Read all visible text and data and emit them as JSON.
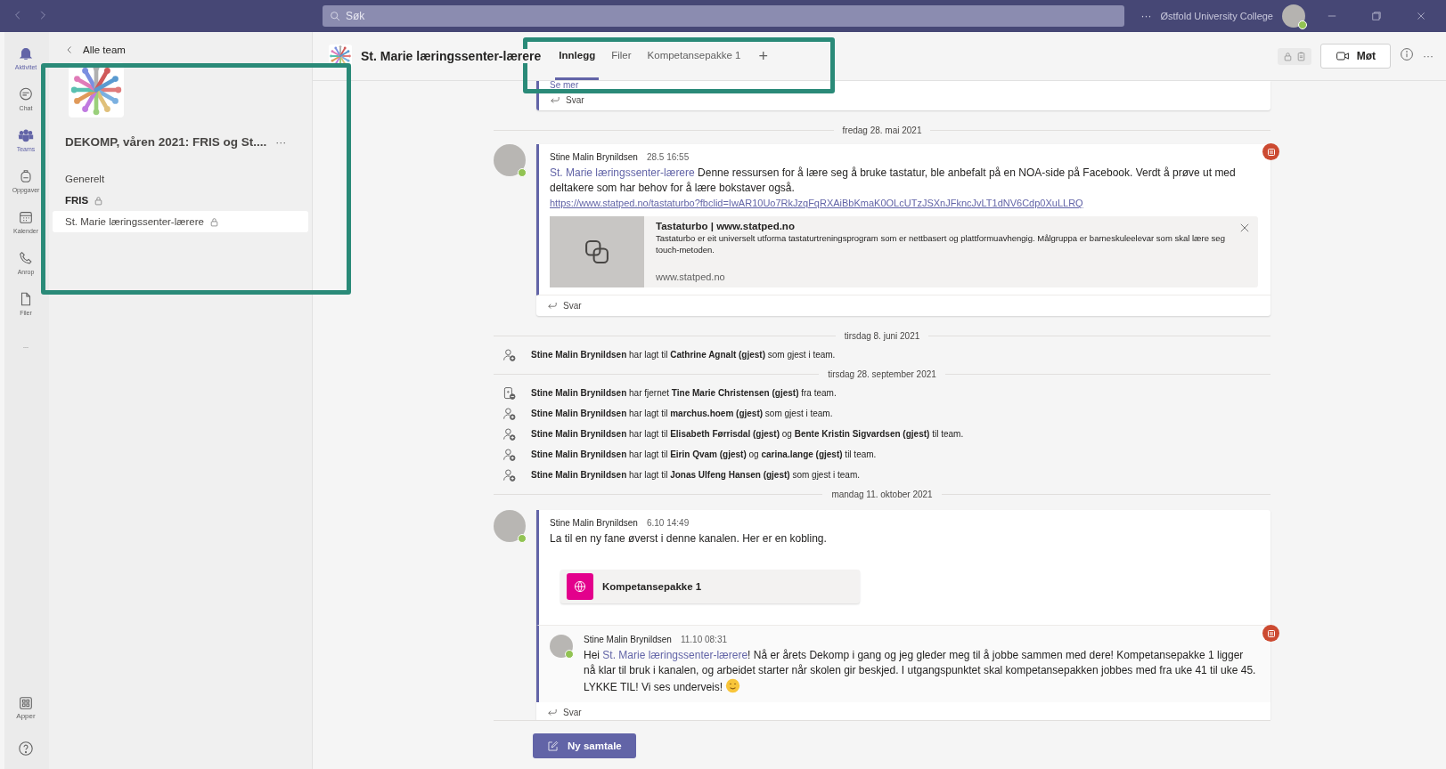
{
  "title_bar": {
    "search_placeholder": "Søk",
    "more": "···",
    "org": "Østfold University College"
  },
  "rail": {
    "items": [
      {
        "kind": "bell",
        "label": "Aktivitet",
        "selected": true
      },
      {
        "kind": "chat",
        "label": "Chat",
        "selected": false
      },
      {
        "kind": "teams",
        "label": "Teams",
        "selected": true
      },
      {
        "kind": "backpack",
        "label": "Oppgaver",
        "selected": false
      },
      {
        "kind": "calendar",
        "label": "Kalender",
        "selected": false
      },
      {
        "kind": "phone",
        "label": "Anrop",
        "selected": false
      },
      {
        "kind": "file",
        "label": "Filer",
        "selected": false
      },
      {
        "kind": "more",
        "label": "...",
        "selected": false
      }
    ],
    "bottom": [
      {
        "kind": "apps",
        "label": "Apper",
        "selected": false
      },
      {
        "kind": "help",
        "selected": false
      }
    ]
  },
  "team_panel": {
    "back": "Alle team",
    "team_name": "DEKOMP, våren 2021: FRIS og St....",
    "more": "···",
    "channels": [
      {
        "name": "Generelt",
        "bold": false,
        "private": false,
        "selected": false
      },
      {
        "name": "FRIS",
        "bold": true,
        "private": true,
        "selected": false
      },
      {
        "name": "St. Marie læringssenter-lærere",
        "bold": false,
        "private": true,
        "selected": true
      }
    ]
  },
  "header": {
    "channel": "St. Marie læringssenter-lærere",
    "tabs": [
      {
        "label": "Innlegg",
        "selected": true
      },
      {
        "label": "Filer",
        "selected": false
      },
      {
        "label": "Kompetansepakke 1",
        "selected": false
      }
    ],
    "add_tab": "+",
    "meet": "Møt",
    "more": "···"
  },
  "feed": [
    {
      "kind": "tail",
      "see_more": "Se mer",
      "reply": "Svar"
    },
    {
      "kind": "date",
      "text": "fredag 28. mai 2021"
    },
    {
      "kind": "post",
      "author": "Stine Malin Brynildsen",
      "time": "28.5 16:55",
      "mention": "St. Marie læringssenter-lærere",
      "text": " Denne ressursen for å lære seg å bruke tastatur, ble anbefalt på en NOA-side på Facebook. Verdt å prøve ut med deltakere som har behov for å lære bokstaver også. ",
      "url": "https://www.statped.no/tastaturbo?fbclid=IwAR10Uo7RkJzqFqRXAiBbKmaK0OLcUTzJSXnJFkncJvLT1dNV6Cdp0XuLLRQ",
      "preview": {
        "title": "Tastaturbo | www.statped.no",
        "description": "Tastaturbo er eit universelt utforma tastaturtreningsprogram som er nettbasert og plattformuavhengig. Målgruppa er barneskuleelevar som skal lære seg touch-metoden.",
        "domain": "www.statped.no"
      },
      "reply": "Svar"
    },
    {
      "kind": "date",
      "text": "tirsdag 8. juni 2021"
    },
    {
      "kind": "member_added",
      "text": "**Stine Malin Brynildsen** har lagt til **Cathrine Agnalt (gjest)** som gjest i team."
    },
    {
      "kind": "date",
      "text": "tirsdag 28. september 2021"
    },
    {
      "kind": "member_removed",
      "text": "**Stine Malin Brynildsen** har fjernet **Tine Marie Christensen (gjest)** fra team."
    },
    {
      "kind": "member_added",
      "text": "**Stine Malin Brynildsen** har lagt til **marchus.hoem (gjest)** som gjest i team."
    },
    {
      "kind": "member_added",
      "text": "**Stine Malin Brynildsen** har lagt til **Elisabeth Førrisdal (gjest)** og **Bente Kristin Sigvardsen (gjest)** til team."
    },
    {
      "kind": "member_added",
      "text": "**Stine Malin Brynildsen** har lagt til **Eirin Qvam (gjest)** og **carina.lange (gjest)** til team."
    },
    {
      "kind": "member_added",
      "text": "**Stine Malin Brynildsen** har lagt til **Jonas Ulfeng Hansen (gjest)** som gjest i team."
    },
    {
      "kind": "date",
      "text": "mandag 11. oktober 2021"
    },
    {
      "kind": "thread",
      "author": "Stine Malin Brynildsen",
      "time": "6.10 14:49",
      "text": "La til en ny fane øverst i denne kanalen. Her er en kobling.",
      "tab_card": "Kompetansepakke 1",
      "reply_post": {
        "author": "Stine Malin Brynildsen",
        "time": "11.10 08:31",
        "prefix": "Hei ",
        "mention": "St. Marie læringssenter-lærere",
        "text": "! Nå er årets Dekomp i gang og jeg gleder meg til å jobbe sammen med dere! Kompetansepakke 1 ligger nå klar til bruk i kanalen, og arbeidet starter når skolen gir beskjed. I utgangspunktet skal kompetansepakken jobbes med fra uke 41 til uke 45. LYKKE TIL! Vi ses underveis!"
      },
      "reply": "Svar"
    }
  ],
  "new_conversation": "Ny samtale"
}
